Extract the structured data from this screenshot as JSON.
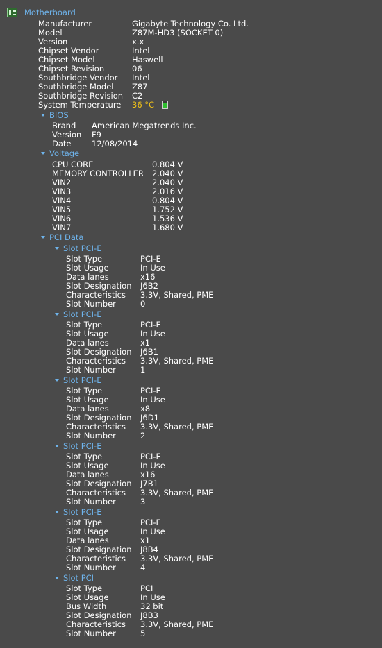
{
  "motherboard": {
    "title": "Motherboard",
    "icon": "motherboard-icon",
    "properties": [
      {
        "label": "Manufacturer",
        "value": "Gigabyte Technology Co. Ltd."
      },
      {
        "label": "Model",
        "value": "Z87M-HD3 (SOCKET 0)"
      },
      {
        "label": "Version",
        "value": "x.x"
      },
      {
        "label": "Chipset Vendor",
        "value": "Intel"
      },
      {
        "label": "Chipset Model",
        "value": "Haswell"
      },
      {
        "label": "Chipset Revision",
        "value": "06"
      },
      {
        "label": "Southbridge Vendor",
        "value": "Intel"
      },
      {
        "label": "Southbridge Model",
        "value": "Z87"
      },
      {
        "label": "Southbridge Revision",
        "value": "C2"
      },
      {
        "label": "System Temperature",
        "value": "36 °C"
      }
    ],
    "temperature_color": "#f2c318",
    "temperature_gauge_level": 0.8
  },
  "bios": {
    "title": "BIOS",
    "properties": [
      {
        "label": "Brand",
        "value": "American Megatrends Inc."
      },
      {
        "label": "Version",
        "value": "F9"
      },
      {
        "label": "Date",
        "value": "12/08/2014"
      }
    ]
  },
  "voltage": {
    "title": "Voltage",
    "properties": [
      {
        "label": "CPU CORE",
        "value": "0.804 V"
      },
      {
        "label": "MEMORY CONTROLLER",
        "value": "2.040 V"
      },
      {
        "label": "VIN2",
        "value": "2.040 V"
      },
      {
        "label": "VIN3",
        "value": "2.016 V"
      },
      {
        "label": "VIN4",
        "value": "0.804 V"
      },
      {
        "label": "VIN5",
        "value": "1.752 V"
      },
      {
        "label": "VIN6",
        "value": "1.536 V"
      },
      {
        "label": "VIN7",
        "value": "1.680 V"
      }
    ]
  },
  "pci": {
    "title": "PCI Data",
    "slots": [
      {
        "title": "Slot PCI-E",
        "properties": [
          {
            "label": "Slot Type",
            "value": "PCI-E"
          },
          {
            "label": "Slot Usage",
            "value": "In Use"
          },
          {
            "label": "Data lanes",
            "value": "x16"
          },
          {
            "label": "Slot Designation",
            "value": "J6B2"
          },
          {
            "label": "Characteristics",
            "value": "3.3V, Shared, PME"
          },
          {
            "label": "Slot Number",
            "value": "0"
          }
        ]
      },
      {
        "title": "Slot PCI-E",
        "properties": [
          {
            "label": "Slot Type",
            "value": "PCI-E"
          },
          {
            "label": "Slot Usage",
            "value": "In Use"
          },
          {
            "label": "Data lanes",
            "value": "x1"
          },
          {
            "label": "Slot Designation",
            "value": "J6B1"
          },
          {
            "label": "Characteristics",
            "value": "3.3V, Shared, PME"
          },
          {
            "label": "Slot Number",
            "value": "1"
          }
        ]
      },
      {
        "title": "Slot PCI-E",
        "properties": [
          {
            "label": "Slot Type",
            "value": "PCI-E"
          },
          {
            "label": "Slot Usage",
            "value": "In Use"
          },
          {
            "label": "Data lanes",
            "value": "x8"
          },
          {
            "label": "Slot Designation",
            "value": "J6D1"
          },
          {
            "label": "Characteristics",
            "value": "3.3V, Shared, PME"
          },
          {
            "label": "Slot Number",
            "value": "2"
          }
        ]
      },
      {
        "title": "Slot PCI-E",
        "properties": [
          {
            "label": "Slot Type",
            "value": "PCI-E"
          },
          {
            "label": "Slot Usage",
            "value": "In Use"
          },
          {
            "label": "Data lanes",
            "value": "x16"
          },
          {
            "label": "Slot Designation",
            "value": "J7B1"
          },
          {
            "label": "Characteristics",
            "value": "3.3V, Shared, PME"
          },
          {
            "label": "Slot Number",
            "value": "3"
          }
        ]
      },
      {
        "title": "Slot PCI-E",
        "properties": [
          {
            "label": "Slot Type",
            "value": "PCI-E"
          },
          {
            "label": "Slot Usage",
            "value": "In Use"
          },
          {
            "label": "Data lanes",
            "value": "x1"
          },
          {
            "label": "Slot Designation",
            "value": "J8B4"
          },
          {
            "label": "Characteristics",
            "value": "3.3V, Shared, PME"
          },
          {
            "label": "Slot Number",
            "value": "4"
          }
        ]
      },
      {
        "title": "Slot PCI",
        "properties": [
          {
            "label": "Slot Type",
            "value": "PCI"
          },
          {
            "label": "Slot Usage",
            "value": "In Use"
          },
          {
            "label": "Bus Width",
            "value": "32 bit"
          },
          {
            "label": "Slot Designation",
            "value": "J8B3"
          },
          {
            "label": "Characteristics",
            "value": "3.3V, Shared, PME"
          },
          {
            "label": "Slot Number",
            "value": "5"
          }
        ]
      }
    ]
  }
}
